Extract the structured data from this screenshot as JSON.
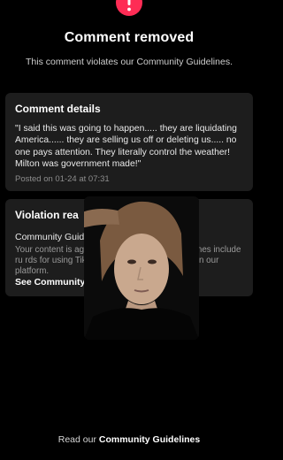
{
  "header": {
    "icon": "warning-icon",
    "title": "Comment removed",
    "subtitle": "This comment violates our Community Guidelines."
  },
  "comment_details": {
    "heading": "Comment details",
    "text": "\"I said this was going to happen..... they are liquidating America...... they are selling us off or deleting us..... no one pays attention. They literally control the weather! Milton was government made!\"",
    "posted": "Posted on 01-24 at 07:31"
  },
  "violation": {
    "heading": "Violation rea",
    "category": "Community Guideline",
    "body": "Your content is again                ity Guidelines. The guidelines include ru              rds for using TikTok that apply to everyo                ing on our platform.",
    "link": "See Community Guid"
  },
  "footer": {
    "prefix": "Read our",
    "link": "Community Guidelines"
  },
  "colors": {
    "background": "#000000",
    "card": "#1d1d1d",
    "warning": "#fe2c55"
  }
}
